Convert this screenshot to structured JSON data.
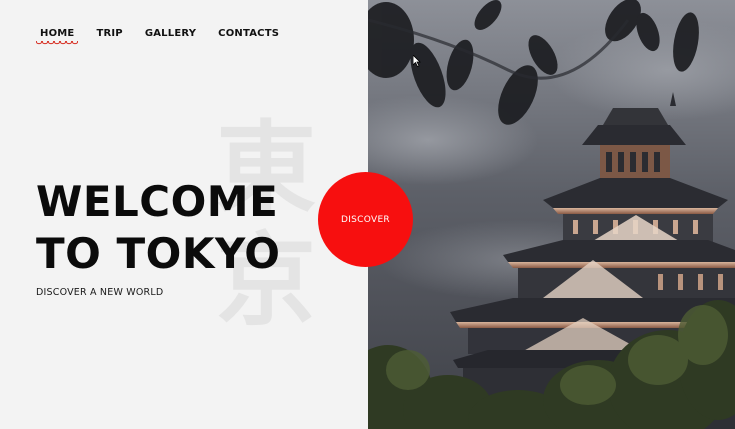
{
  "nav": {
    "items": [
      {
        "label": "HOME",
        "active": true
      },
      {
        "label": "TRIP",
        "active": false
      },
      {
        "label": "GALLERY",
        "active": false
      },
      {
        "label": "CONTACTS",
        "active": false
      }
    ]
  },
  "hero": {
    "watermark_chars": [
      "東",
      "京"
    ],
    "title_line1": "WELCOME",
    "title_line2": "TO TOKYO",
    "subtitle": "DISCOVER A NEW WORLD",
    "cta_label": "DISCOVER"
  },
  "colors": {
    "accent": "#f70f0f",
    "nav_underline": "#d62b1f",
    "background": "#f3f3f3",
    "text": "#0b0b0b"
  }
}
